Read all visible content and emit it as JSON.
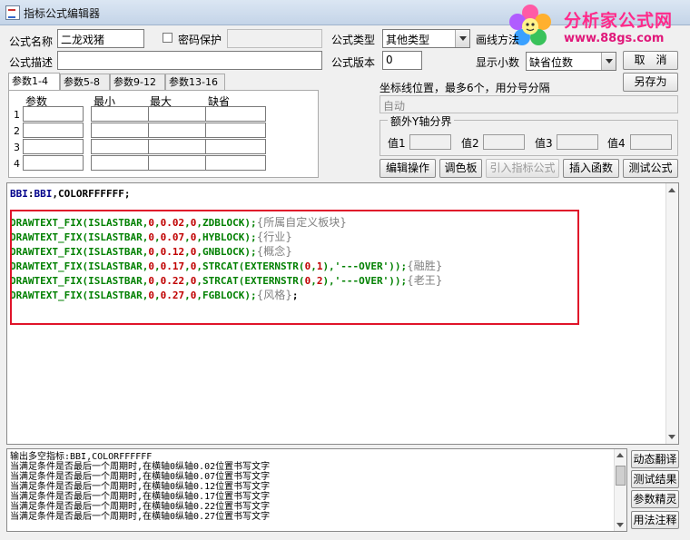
{
  "window": {
    "title": "指标公式编辑器"
  },
  "logo": {
    "brand_text": "分析家公式网",
    "url_text": "www.88gs.com"
  },
  "header": {
    "name_label": "公式名称",
    "name_value": "二龙戏猪",
    "password_label": "密码保护",
    "password_checked": false,
    "type_label": "公式类型",
    "type_value": "其他类型",
    "draw_method_label": "画线方法",
    "desc_label": "公式描述",
    "desc_value": "",
    "version_label": "公式版本",
    "version_value": "0",
    "decimals_label": "显示小数",
    "decimals_value": "缺省位数",
    "cancel_button": "取　消",
    "save_as_button": "另存为"
  },
  "param_tabs": [
    "参数1-4",
    "参数5-8",
    "参数9-12",
    "参数13-16"
  ],
  "param_table": {
    "headers": [
      "参数",
      "最小",
      "最大",
      "缺省"
    ],
    "row_numbers": [
      "1",
      "2",
      "3",
      "4"
    ]
  },
  "axis": {
    "label": "坐标线位置，最多6个，用分号分隔",
    "value": "自动",
    "extra_group_title": "额外Y轴分界",
    "value_labels": [
      "值1",
      "值2",
      "值3",
      "值4"
    ]
  },
  "toolbar": {
    "edit_ops": "编辑操作",
    "palette": "调色板",
    "import_indicator": "引入指标公式",
    "insert_function": "插入函数",
    "test_formula": "测试公式"
  },
  "code": {
    "line1": {
      "a": "BBI",
      "b": ":",
      "c": "BBI",
      "d": ",COLORFFFFFF;"
    },
    "highlight_lines": [
      {
        "fn": "DRAWTEXT_FIX",
        "p1": "(ISLASTBAR,",
        "n1": "0",
        "s1": ",",
        "n2": "0.02",
        "s2": ",",
        "n3": "0",
        "rest": ",ZDBLOCK);",
        "comment": "{所属自定义板块}"
      },
      {
        "fn": "DRAWTEXT_FIX",
        "p1": "(ISLASTBAR,",
        "n1": "0",
        "s1": ",",
        "n2": "0.07",
        "s2": ",",
        "n3": "0",
        "rest": ",HYBLOCK);",
        "comment": "{行业}"
      },
      {
        "fn": "DRAWTEXT_FIX",
        "p1": "(ISLASTBAR,",
        "n1": "0",
        "s1": ",",
        "n2": "0.12",
        "s2": ",",
        "n3": "0",
        "rest": ",GNBLOCK);",
        "comment": "{概念}"
      },
      {
        "fn": "DRAWTEXT_FIX",
        "p1": "(ISLASTBAR,",
        "n1": "0",
        "s1": ",",
        "n2": "0.17",
        "s2": ",",
        "n3": "0",
        "rest": ",STRCAT(EXTERNSTR(",
        "n4": "0",
        "s4": ",",
        "n5": "1",
        "rest2": "),'---OVER'));",
        "comment": "{融胜}"
      },
      {
        "fn": "DRAWTEXT_FIX",
        "p1": "(ISLASTBAR,",
        "n1": "0",
        "s1": ",",
        "n2": "0.22",
        "s2": ",",
        "n3": "0",
        "rest": ",STRCAT(EXTERNSTR(",
        "n4": "0",
        "s4": ",",
        "n5": "2",
        "rest2": "),'---OVER'));",
        "comment": "{老王}"
      },
      {
        "fn": "DRAWTEXT_FIX",
        "p1": "(ISLASTBAR,",
        "n1": "0",
        "s1": ",",
        "n2": "0.27",
        "s2": ",",
        "n3": "0",
        "rest": ",FGBLOCK);",
        "comment": "{风格}",
        "tail": ";"
      }
    ]
  },
  "output": {
    "lines": [
      "输出多空指标:BBI,COLORFFFFFF",
      "当满足条件是否最后一个周期时,在横轴0纵轴0.02位置书写文字",
      "当满足条件是否最后一个周期时,在横轴0纵轴0.07位置书写文字",
      "当满足条件是否最后一个周期时,在横轴0纵轴0.12位置书写文字",
      "当满足条件是否最后一个周期时,在横轴0纵轴0.17位置书写文字",
      "当满足条件是否最后一个周期时,在横轴0纵轴0.22位置书写文字",
      "当满足条件是否最后一个周期时,在横轴0纵轴0.27位置书写文字"
    ]
  },
  "side_buttons": {
    "dynamic_translate": "动态翻译",
    "test_result": "测试结果",
    "param_wizard": "参数精灵",
    "usage_notes": "用法注释"
  }
}
